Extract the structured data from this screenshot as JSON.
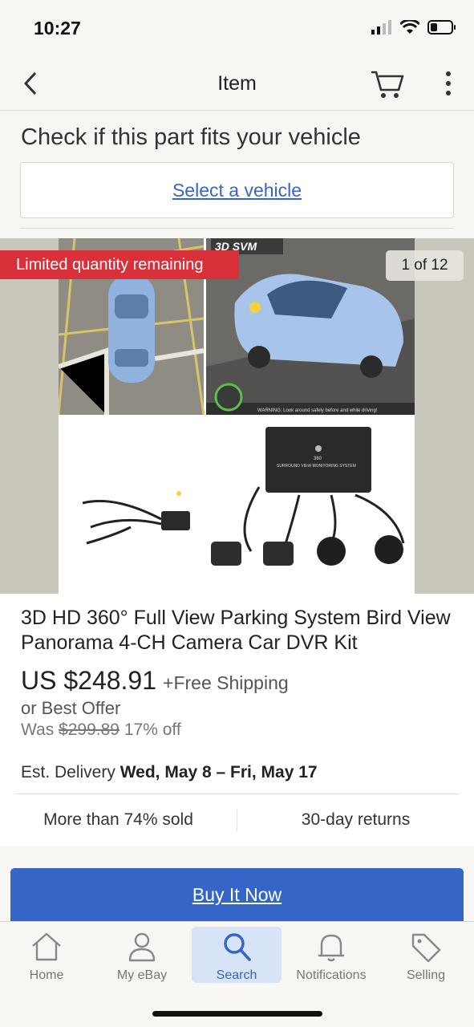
{
  "status_bar": {
    "time": "10:27"
  },
  "nav": {
    "title": "Item"
  },
  "fitment": {
    "heading": "Check if this part fits your vehicle",
    "link": "Select a vehicle"
  },
  "gallery": {
    "banner": "Limited quantity remaining",
    "counter": "1 of 12",
    "image_text": {
      "brand": "3D SVM",
      "device_label": "360",
      "device_sub": "SURROUND VIEW MONITORING SYSTEM",
      "warning": "WARNING: Look around safely before and while driving!"
    }
  },
  "item": {
    "title": "3D HD 360° Full View Parking System Bird View Panorama 4-CH Camera Car DVR Kit",
    "price": "US $248.91",
    "shipping": "+Free Shipping",
    "best_offer": "or Best Offer",
    "was_label": "Was",
    "was_price": "$299.89",
    "discount": "17% off",
    "delivery_label": "Est. Delivery",
    "delivery_dates": "Wed, May 8 – Fri, May 17",
    "sold": "More than 74% sold",
    "returns": "30-day returns"
  },
  "buy_button": "Buy It Now",
  "tabs": [
    {
      "label": "Home",
      "icon": "home-icon"
    },
    {
      "label": "My eBay",
      "icon": "person-icon"
    },
    {
      "label": "Search",
      "icon": "search-icon"
    },
    {
      "label": "Notifications",
      "icon": "bell-icon"
    },
    {
      "label": "Selling",
      "icon": "tag-icon"
    }
  ],
  "colors": {
    "accent": "#3665c8",
    "banner": "#d9303a",
    "background": "#f7f6f3"
  }
}
